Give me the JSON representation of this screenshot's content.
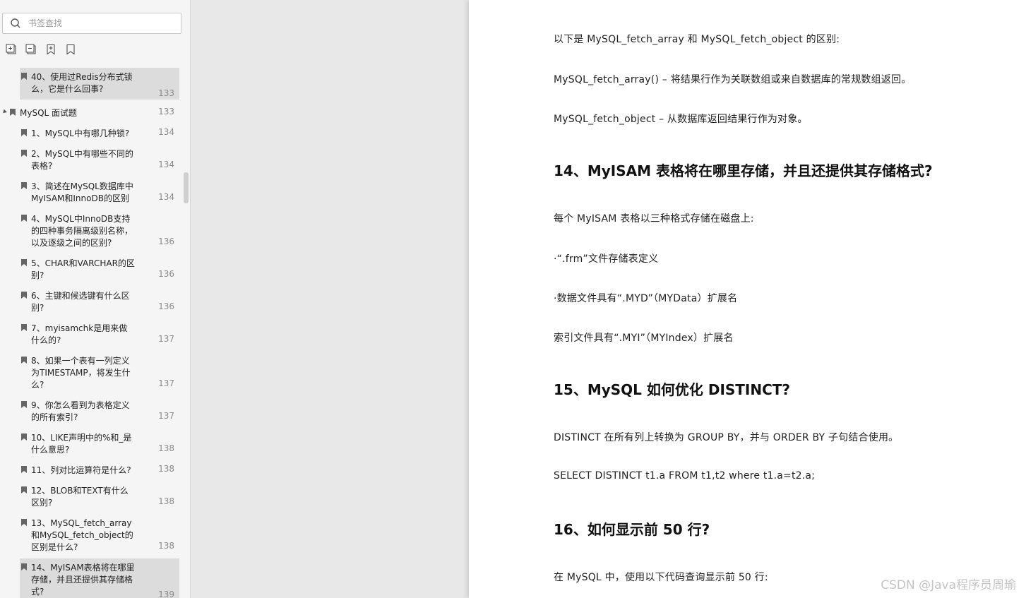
{
  "sidebar": {
    "search_placeholder": "书签查找",
    "tools": [
      "expand-all-icon",
      "collapse-all-icon",
      "add-bookmark-icon",
      "bookmark-icon"
    ],
    "items": [
      {
        "level": "child",
        "text": "40、使用过Redis分布式锁么，它是什么回事?",
        "page": "133",
        "selected": true
      },
      {
        "level": "parent",
        "text": "MySQL 面试题",
        "page": "133"
      },
      {
        "level": "child",
        "text": "1、MySQL中有哪几种锁?",
        "page": "134"
      },
      {
        "level": "child",
        "text": "2、MySQL中有哪些不同的表格?",
        "page": "134"
      },
      {
        "level": "child",
        "text": "3、简述在MySQL数据库中MyISAM和InnoDB的区别",
        "page": "134"
      },
      {
        "level": "child",
        "text": "4、MySQL中InnoDB支持的四种事务隔离级别名称，以及逐级之间的区别?",
        "page": "136"
      },
      {
        "level": "child",
        "text": "5、CHAR和VARCHAR的区别?",
        "page": "136"
      },
      {
        "level": "child",
        "text": "6、主键和候选键有什么区别?",
        "page": "136"
      },
      {
        "level": "child",
        "text": "7、myisamchk是用来做什么的?",
        "page": "137"
      },
      {
        "level": "child",
        "text": "8、如果一个表有一列定义为TIMESTAMP，将发生什么?",
        "page": "137"
      },
      {
        "level": "child",
        "text": "9、你怎么看到为表格定义的所有索引?",
        "page": "137"
      },
      {
        "level": "child",
        "text": "10、LIKE声明中的%和_是什么意思?",
        "page": "138"
      },
      {
        "level": "child",
        "text": "11、列对比运算符是什么?",
        "page": "138"
      },
      {
        "level": "child",
        "text": "12、BLOB和TEXT有什么区别?",
        "page": "138"
      },
      {
        "level": "child",
        "text": "13、MySQL_fetch_array和MySQL_fetch_object的区别是什么?",
        "page": "138"
      },
      {
        "level": "child",
        "text": "14、MyISAM表格将在哪里存储，并且还提供其存储格式?",
        "page": "139",
        "selected": true
      }
    ]
  },
  "document": {
    "p1": "以下是 MySQL_fetch_array 和 MySQL_fetch_object 的区别:",
    "p2": "MySQL_fetch_array() – 将结果行作为关联数组或来自数据库的常规数组返回。",
    "p3": "MySQL_fetch_object – 从数据库返回结果行作为对象。",
    "h14": "14、MyISAM 表格将在哪里存储，并且还提供其存储格式?",
    "p4": "每个 MyISAM 表格以三种格式存储在磁盘上:",
    "p5": "·“.frm”文件存储表定义",
    "p6": "·数据文件具有“.MYD”（MYData）扩展名",
    "p7": "索引文件具有“.MYI”（MYIndex）扩展名",
    "h15": "15、MySQL 如何优化 DISTINCT?",
    "p8": "DISTINCT 在所有列上转换为 GROUP BY，并与 ORDER BY 子句结合使用。",
    "p9": "SELECT DISTINCT t1.a FROM t1,t2 where t1.a=t2.a;",
    "h16": "16、如何显示前 50 行?",
    "p10": "在 MySQL 中，使用以下代码查询显示前 50 行:"
  },
  "watermark": "CSDN @Java程序员周瑜"
}
